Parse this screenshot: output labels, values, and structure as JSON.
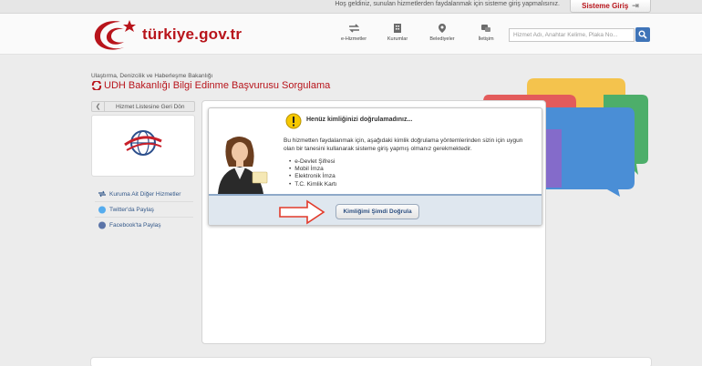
{
  "topbar": {
    "welcome": "Hoş geldiniz, sunulan hizmetlerden faydalanmak için sisteme giriş yapmalısınız.",
    "login_label": "Sisteme Giriş"
  },
  "header": {
    "logo_text": "türkiye.gov.tr",
    "nav": [
      {
        "label": "e-Hizmetler",
        "icon": "arrows-icon"
      },
      {
        "label": "Kurumlar",
        "icon": "building-icon"
      },
      {
        "label": "Belediyeler",
        "icon": "pin-icon"
      },
      {
        "label": "İletişim",
        "icon": "contact-icon"
      }
    ],
    "search_placeholder": "Hizmet Adı, Anahtar Kelime, Plaka No..."
  },
  "breadcrumb": "Ulaştırma, Denizcilik ve Haberleşme Bakanlığı",
  "page_title": "UDH Bakanlığı Bilgi Edinme Başvurusu Sorgulama",
  "sidebar": {
    "back_label": "Hizmet Listesine Geri Dön",
    "links": [
      {
        "label": "Kuruma Ait Diğer Hizmetler"
      },
      {
        "label": "Twitter'da Paylaş"
      },
      {
        "label": "Facebook'ta Paylaş"
      }
    ]
  },
  "notice": {
    "title": "Henüz kimliğinizi doğrulamadınız...",
    "description": "Bu hizmetten faydalanmak için, aşağıdaki kimlik doğrulama yöntemlerinden sizin için uygun olan bir tanesini kullanarak sisteme giriş yapmış olmanız gerekmektedir.",
    "methods": [
      "e-Devlet Şifresi",
      "Mobil İmza",
      "Elektronik İmza",
      "T.C. Kimlik Kartı"
    ],
    "verify_label": "Kimliğimi Şimdi Doğrula"
  },
  "colors": {
    "brand_red": "#b8141b",
    "link_blue": "#34598a",
    "search_blue": "#3f74b8"
  }
}
